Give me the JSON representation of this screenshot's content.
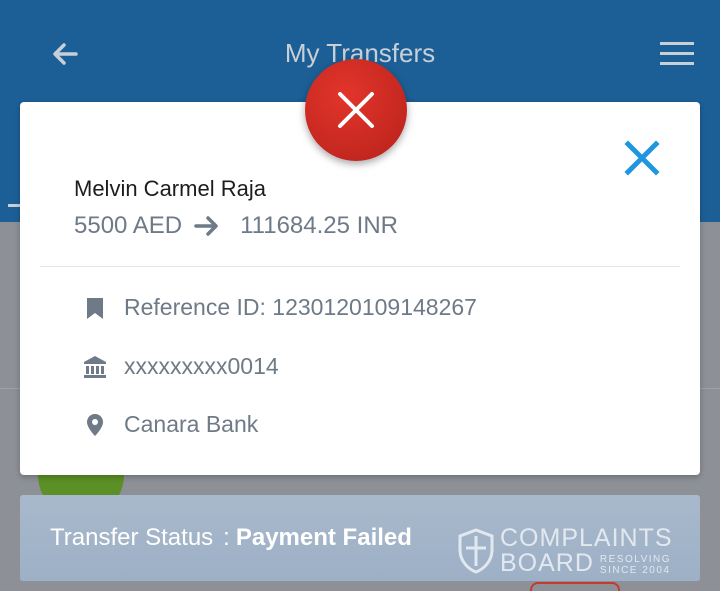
{
  "appbar": {
    "title": "My Transfers",
    "back_icon": "arrow-left-icon",
    "menu_icon": "hamburger-menu-icon"
  },
  "dialog": {
    "status_icon": "error-x-icon",
    "close_icon": "close-icon",
    "recipient_name": "Melvin Carmel Raja",
    "send_amount": "5500 AED",
    "arrow_icon": "arrow-right-icon",
    "receive_amount": "111684.25 INR",
    "info": [
      {
        "icon": "bookmark-icon",
        "text": "Reference ID: 1230120109148267"
      },
      {
        "icon": "bank-icon",
        "text": "xxxxxxxxx0014"
      },
      {
        "icon": "location-pin-icon",
        "text": "Canara Bank"
      }
    ]
  },
  "status": {
    "label": "Transfer Status",
    "separator": ":",
    "value": "Payment Failed"
  },
  "watermark": {
    "line1": "COMPLAINTS",
    "line2": "BOARD",
    "tag1": "RESOLVING",
    "tag2": "SINCE 2004"
  },
  "colors": {
    "appbar": "#1c5f96",
    "error_red": "#d12a21",
    "close_blue": "#2196e0",
    "status_bar": "#a9b9cc"
  }
}
